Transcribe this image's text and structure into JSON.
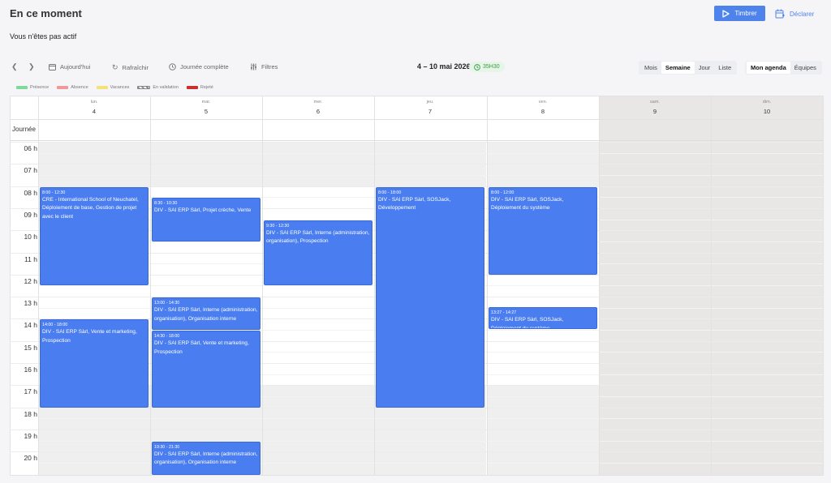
{
  "header": {
    "title": "En ce moment",
    "status": "Vous n'êtes pas actif",
    "timbrer_label": "Timbrer",
    "declarer_label": "Déclarer"
  },
  "toolbar": {
    "today_label": "Aujourd'hui",
    "refresh_label": "Rafraîchir",
    "fullday_label": "Journée complète",
    "filters_label": "Filtres",
    "date_range": "4 – 10 mai 2026",
    "duration": "35H30",
    "views": [
      "Mois",
      "Semaine",
      "Jour",
      "Liste"
    ],
    "active_view": "Semaine",
    "scopes": [
      "Mon agenda",
      "Équipes"
    ],
    "active_scope": "Mon agenda"
  },
  "legend": [
    {
      "label": "Présence",
      "color": "#7ed99a"
    },
    {
      "label": "Absence",
      "color": "#ef9a9a"
    },
    {
      "label": "Vacances",
      "color": "#f3e27a"
    },
    {
      "label": "En validation",
      "color": "#888888"
    },
    {
      "label": "Rejeté",
      "color": "#c9302c"
    }
  ],
  "calendar": {
    "allday_label": "Journée",
    "days": [
      {
        "name": "lun.",
        "num": "4"
      },
      {
        "name": "mar.",
        "num": "5"
      },
      {
        "name": "mer.",
        "num": "6"
      },
      {
        "name": "jeu.",
        "num": "7"
      },
      {
        "name": "ven.",
        "num": "8"
      },
      {
        "name": "sam.",
        "num": "9"
      },
      {
        "name": "dim.",
        "num": "10"
      }
    ],
    "hours": [
      "06 h",
      "07 h",
      "08 h",
      "09 h",
      "10 h",
      "11 h",
      "12 h",
      "13 h",
      "14 h",
      "15 h",
      "16 h",
      "17 h",
      "18 h",
      "19 h",
      "20 h"
    ],
    "events": [
      {
        "day": 0,
        "start": 8.0,
        "end": 12.5,
        "time": "8:00 - 12:30",
        "text": "CRE - International School of Neuchatel, Déploiement de base, Gestion de projet avec le client"
      },
      {
        "day": 0,
        "start": 14.0,
        "end": 18.0,
        "time": "14:00 - 18:00",
        "text": "DIV - SAI ERP Sàrl, Vente et marketing, Prospection"
      },
      {
        "day": 1,
        "start": 8.5,
        "end": 10.5,
        "time": "8:30 - 10:30",
        "text": "DIV - SAI ERP Sàrl, Projet crèche, Vente"
      },
      {
        "day": 1,
        "start": 13.0,
        "end": 14.5,
        "time": "13:00 - 14:30",
        "text": "DIV - SAI ERP Sàrl, Interne (administration, organisation), Organisation interne"
      },
      {
        "day": 1,
        "start": 14.5,
        "end": 18.0,
        "time": "14:30 - 18:00",
        "text": "DIV - SAI ERP Sàrl, Vente et marketing, Prospection"
      },
      {
        "day": 1,
        "start": 19.5,
        "end": 21.5,
        "time": "19:30 - 21:30",
        "text": "DIV - SAI ERP Sàrl, Interne (administration, organisation), Organisation interne"
      },
      {
        "day": 2,
        "start": 9.5,
        "end": 12.5,
        "time": "9:30 - 12:30",
        "text": "DIV - SAI ERP Sàrl, Interne (administration, organisation), Prospection"
      },
      {
        "day": 3,
        "start": 8.0,
        "end": 18.0,
        "time": "8:00 - 18:00",
        "text": "DIV - SAI ERP Sàrl, SOSJack, Développement"
      },
      {
        "day": 4,
        "start": 8.0,
        "end": 12.0,
        "time": "8:00 - 12:00",
        "text": "DIV - SAI ERP Sàrl, SOSJack, Déploiement du système"
      },
      {
        "day": 4,
        "start": 13.45,
        "end": 14.45,
        "time": "13:27 - 14:27",
        "text": "DIV - SAI ERP Sàrl, SOSJack, Déploiement du système"
      }
    ]
  },
  "colors": {
    "accent": "#4e83ec",
    "event_bg": "#4a7ef0",
    "offhours_bg": "#efefef",
    "weekend_bg": "#e8e7e5"
  }
}
